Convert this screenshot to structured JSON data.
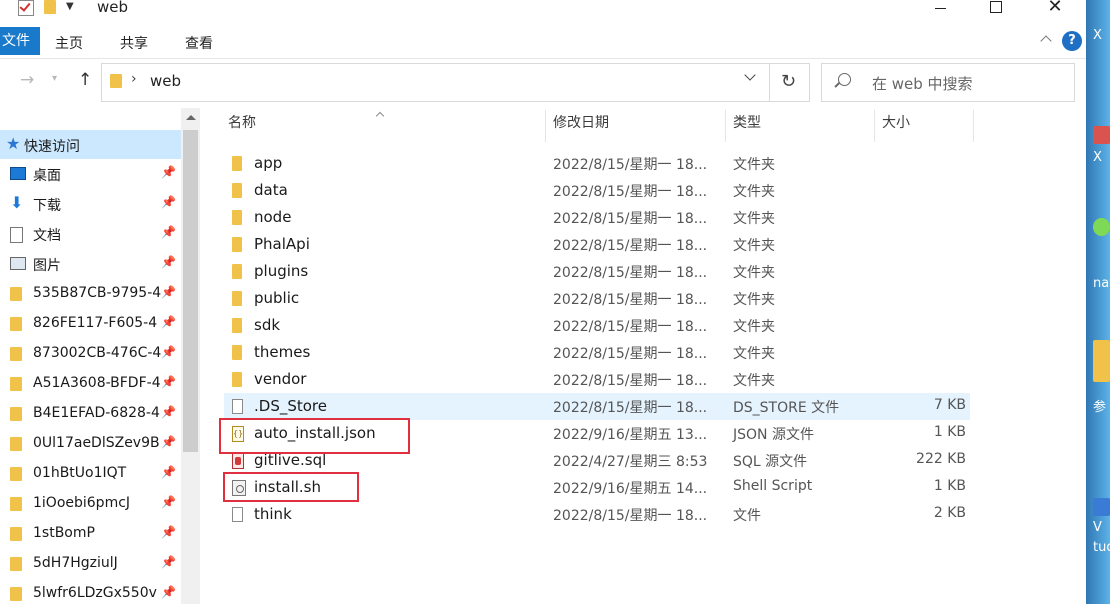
{
  "window": {
    "title": "web"
  },
  "ribbon": {
    "file_tab": "文件",
    "tabs": [
      "主页",
      "共享",
      "查看"
    ],
    "help": "?"
  },
  "address": {
    "separator": "›",
    "path": "web",
    "search_placeholder": "在 web 中搜索"
  },
  "sidebar": {
    "quick_access": "快速访问",
    "items": [
      {
        "label": "桌面",
        "icon": "desktop-icon"
      },
      {
        "label": "下载",
        "icon": "download-icon"
      },
      {
        "label": "文档",
        "icon": "document-icon"
      },
      {
        "label": "图片",
        "icon": "picture-icon"
      },
      {
        "label": "535B87CB-9795-4",
        "icon": "folder-icon"
      },
      {
        "label": "826FE117-F605-4",
        "icon": "folder-icon"
      },
      {
        "label": "873002CB-476C-4",
        "icon": "folder-icon"
      },
      {
        "label": "A51A3608-BFDF-4",
        "icon": "folder-icon"
      },
      {
        "label": "B4E1EFAD-6828-4",
        "icon": "folder-icon"
      },
      {
        "label": "0Ul17aeDlSZev9B",
        "icon": "folder-icon"
      },
      {
        "label": "01hBtUo1IQT",
        "icon": "folder-icon"
      },
      {
        "label": "1iOoebi6pmcJ",
        "icon": "folder-icon"
      },
      {
        "label": "1stBomP",
        "icon": "folder-icon"
      },
      {
        "label": "5dH7HgziulJ",
        "icon": "folder-icon"
      },
      {
        "label": "5lwfr6LDzGx550v",
        "icon": "folder-icon"
      }
    ]
  },
  "columns": {
    "name": "名称",
    "date": "修改日期",
    "type": "类型",
    "size": "大小"
  },
  "files": [
    {
      "name": "app",
      "date": "2022/8/15/星期一 18...",
      "type": "文件夹",
      "size": "",
      "icon": "folder"
    },
    {
      "name": "data",
      "date": "2022/8/15/星期一 18...",
      "type": "文件夹",
      "size": "",
      "icon": "folder"
    },
    {
      "name": "node",
      "date": "2022/8/15/星期一 18...",
      "type": "文件夹",
      "size": "",
      "icon": "folder"
    },
    {
      "name": "PhalApi",
      "date": "2022/8/15/星期一 18...",
      "type": "文件夹",
      "size": "",
      "icon": "folder"
    },
    {
      "name": "plugins",
      "date": "2022/8/15/星期一 18...",
      "type": "文件夹",
      "size": "",
      "icon": "folder"
    },
    {
      "name": "public",
      "date": "2022/8/15/星期一 18...",
      "type": "文件夹",
      "size": "",
      "icon": "folder"
    },
    {
      "name": "sdk",
      "date": "2022/8/15/星期一 18...",
      "type": "文件夹",
      "size": "",
      "icon": "folder"
    },
    {
      "name": "themes",
      "date": "2022/8/15/星期一 18...",
      "type": "文件夹",
      "size": "",
      "icon": "folder"
    },
    {
      "name": "vendor",
      "date": "2022/8/15/星期一 18...",
      "type": "文件夹",
      "size": "",
      "icon": "folder"
    },
    {
      "name": ".DS_Store",
      "date": "2022/8/15/星期一 18...",
      "type": "DS_STORE 文件",
      "size": "7 KB",
      "icon": "file"
    },
    {
      "name": "auto_install.json",
      "date": "2022/9/16/星期五 13...",
      "type": "JSON 源文件",
      "size": "1 KB",
      "icon": "json"
    },
    {
      "name": "gitlive.sql",
      "date": "2022/4/27/星期三 8:53",
      "type": "SQL 源文件",
      "size": "222 KB",
      "icon": "sql"
    },
    {
      "name": "install.sh",
      "date": "2022/9/16/星期五 14...",
      "type": "Shell Script",
      "size": "1 KB",
      "icon": "sh"
    },
    {
      "name": "think",
      "date": "2022/8/15/星期一 18...",
      "type": "文件",
      "size": "2 KB",
      "icon": "file"
    }
  ],
  "desktop": {
    "labels": [
      "X",
      "X",
      "navi",
      "参",
      "V",
      "tud"
    ]
  },
  "colors": {
    "accent": "#1979ca",
    "selection": "#cce8ff",
    "hover_row": "#e5f3ff",
    "highlight_box": "#e03040"
  }
}
